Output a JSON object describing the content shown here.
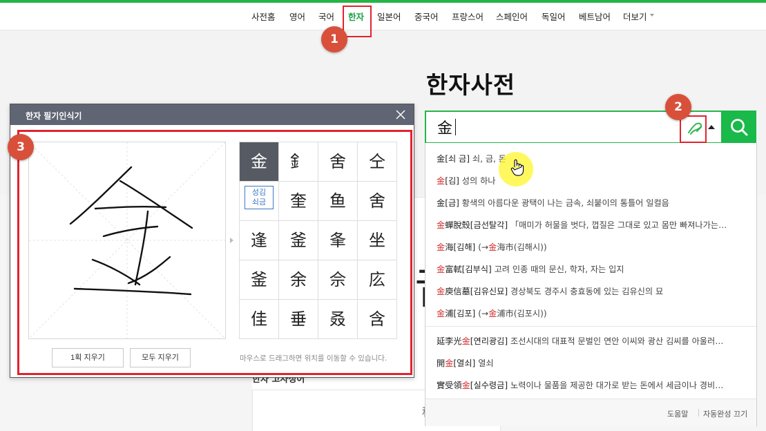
{
  "nav": {
    "items": [
      "사전홈",
      "영어",
      "국어",
      "한자",
      "일본어",
      "중국어",
      "프랑스어",
      "스페인어",
      "독일어",
      "베트남어",
      "더보기"
    ],
    "active": "한자"
  },
  "badges": {
    "one": "1",
    "two": "2",
    "three": "3"
  },
  "page_title": "한자사전",
  "search": {
    "value": "金"
  },
  "autocomplete": {
    "items": [
      {
        "head": "金",
        "reading": "[쇠 금]",
        "desc": "쇠, 금, 돈"
      },
      {
        "head": "金",
        "reading": "[김]",
        "desc": "성의 하나"
      },
      {
        "head": "金",
        "reading": "[금]",
        "desc": "황색의 아름다운 광택이 나는 금속, 쇠붙이의 통틀어 일컬음"
      },
      {
        "head": "金蟬脫殼",
        "reading": "[금선탈각]",
        "desc": "「매미가 허물을 벗다, 껍질은 그대로 있고 몸만 빠져나가는…"
      },
      {
        "head": "金海",
        "reading": "[김해]",
        "desc": "(→金海市(김해시))"
      },
      {
        "head": "金富軾",
        "reading": "[김부식]",
        "desc": "고려 인종 때의 문신, 학자, 자는 입지"
      },
      {
        "head": "金庾信墓",
        "reading": "[김유신묘]",
        "desc": "경상북도 경주시 충효동에 있는 김유신의 묘"
      },
      {
        "head": "金浦",
        "reading": "[김포]",
        "desc": "(→金浦市(김포시))"
      },
      {
        "head": "延李光金",
        "reading": "[연리광김]",
        "desc": "조선시대의 대표적 문벌인 연안 이씨와 광산 김씨를 아울러…"
      },
      {
        "head": "開金",
        "reading": "[열쇠]",
        "desc": "열쇠"
      },
      {
        "head": "實受領金",
        "reading": "[실수령금]",
        "desc": "노력이나 물품을 제공한 대가로 받는 돈에서 세금이나 경비…"
      }
    ],
    "footer_help": "도움말",
    "footer_off": "자동완성 끄기"
  },
  "handwriting": {
    "title": "한자 필기인식기",
    "candidates": [
      "金",
      "釒",
      "舍",
      "仝",
      "",
      "奎",
      "鱼",
      "舍",
      "逢",
      "釜",
      "夆",
      "坐",
      "釜",
      "余",
      "佘",
      "庅",
      "佳",
      "垂",
      "叒",
      "含"
    ],
    "reading_line1": "성김",
    "reading_line2": "쇠금",
    "clear_one": "1획 지우기",
    "clear_all": "모두 지우기",
    "hint": "마우스로 드래그하면 위치를 이동할 수 있습니다."
  },
  "background": {
    "big_char": "音",
    "subhead": "한자 고사성어",
    "card_char": "秋"
  },
  "colors": {
    "accent_green": "#27b447",
    "highlight_red": "#e2222e",
    "badge": "#d9503a"
  }
}
